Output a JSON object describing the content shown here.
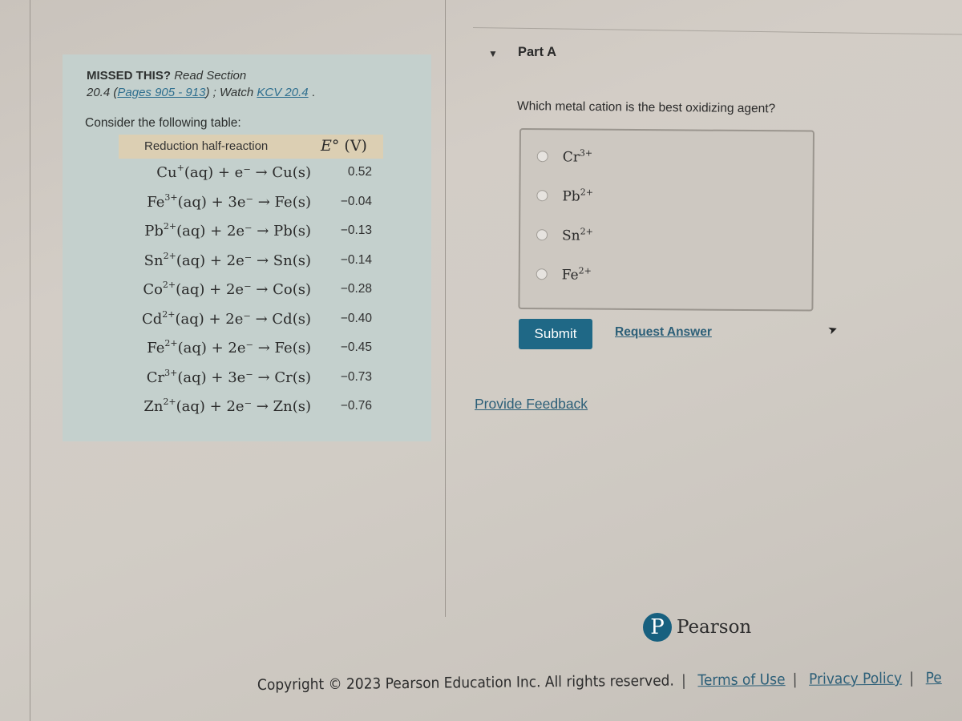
{
  "info_panel": {
    "missed_bold": "MISSED THIS?",
    "missed_italic": "Read Section",
    "section": "20.4",
    "pages_link": "Pages 905 - 913",
    "watch_text": "; Watch",
    "kcv_link": "KCV 20.4",
    "consider": "Consider the following table:",
    "table": {
      "headers": {
        "reaction": "Reduction half-reaction",
        "e_symbol": "E°",
        "e_unit": "(V)"
      },
      "rows": [
        {
          "ion": "Cu",
          "charge": "+",
          "rest": "(aq) + e⁻ → Cu(s)",
          "value": "0.52"
        },
        {
          "ion": "Fe",
          "charge": "3+",
          "rest": "(aq) + 3e⁻ → Fe(s)",
          "value": "−0.04"
        },
        {
          "ion": "Pb",
          "charge": "2+",
          "rest": "(aq) + 2e⁻ → Pb(s)",
          "value": "−0.13"
        },
        {
          "ion": "Sn",
          "charge": "2+",
          "rest": "(aq) + 2e⁻ → Sn(s)",
          "value": "−0.14"
        },
        {
          "ion": "Co",
          "charge": "2+",
          "rest": "(aq) + 2e⁻ → Co(s)",
          "value": "−0.28"
        },
        {
          "ion": "Cd",
          "charge": "2+",
          "rest": "(aq) + 2e⁻ → Cd(s)",
          "value": "−0.40"
        },
        {
          "ion": "Fe",
          "charge": "2+",
          "rest": "(aq) + 2e⁻ → Fe(s)",
          "value": "−0.45"
        },
        {
          "ion": "Cr",
          "charge": "3+",
          "rest": "(aq) + 3e⁻ → Cr(s)",
          "value": "−0.73"
        },
        {
          "ion": "Zn",
          "charge": "2+",
          "rest": "(aq) + 2e⁻ → Zn(s)",
          "value": "−0.76"
        }
      ]
    }
  },
  "part": {
    "toggle_icon": "caret-down-icon",
    "title": "Part A",
    "question": "Which metal cation is the best oxidizing agent?",
    "options": [
      {
        "ion": "Cr",
        "charge": "3+",
        "selected": false
      },
      {
        "ion": "Pb",
        "charge": "2+",
        "selected": false
      },
      {
        "ion": "Sn",
        "charge": "2+",
        "selected": false
      },
      {
        "ion": "Fe",
        "charge": "2+",
        "selected": false
      }
    ],
    "submit_label": "Submit",
    "request_answer_label": "Request Answer",
    "provide_feedback_label": "Provide Feedback"
  },
  "brand": {
    "logo_letter": "P",
    "name": "Pearson",
    "color": "#17607f"
  },
  "footer": {
    "copyright": "Copyright © 2023 Pearson Education Inc. All rights reserved.",
    "links": [
      "Terms of Use",
      "Privacy Policy",
      "Pe"
    ]
  },
  "colors": {
    "submit_bg": "#1f6886",
    "link": "#2c5f78",
    "panel_bg": "#c4d0cd",
    "header_bg": "#dccfb3"
  }
}
